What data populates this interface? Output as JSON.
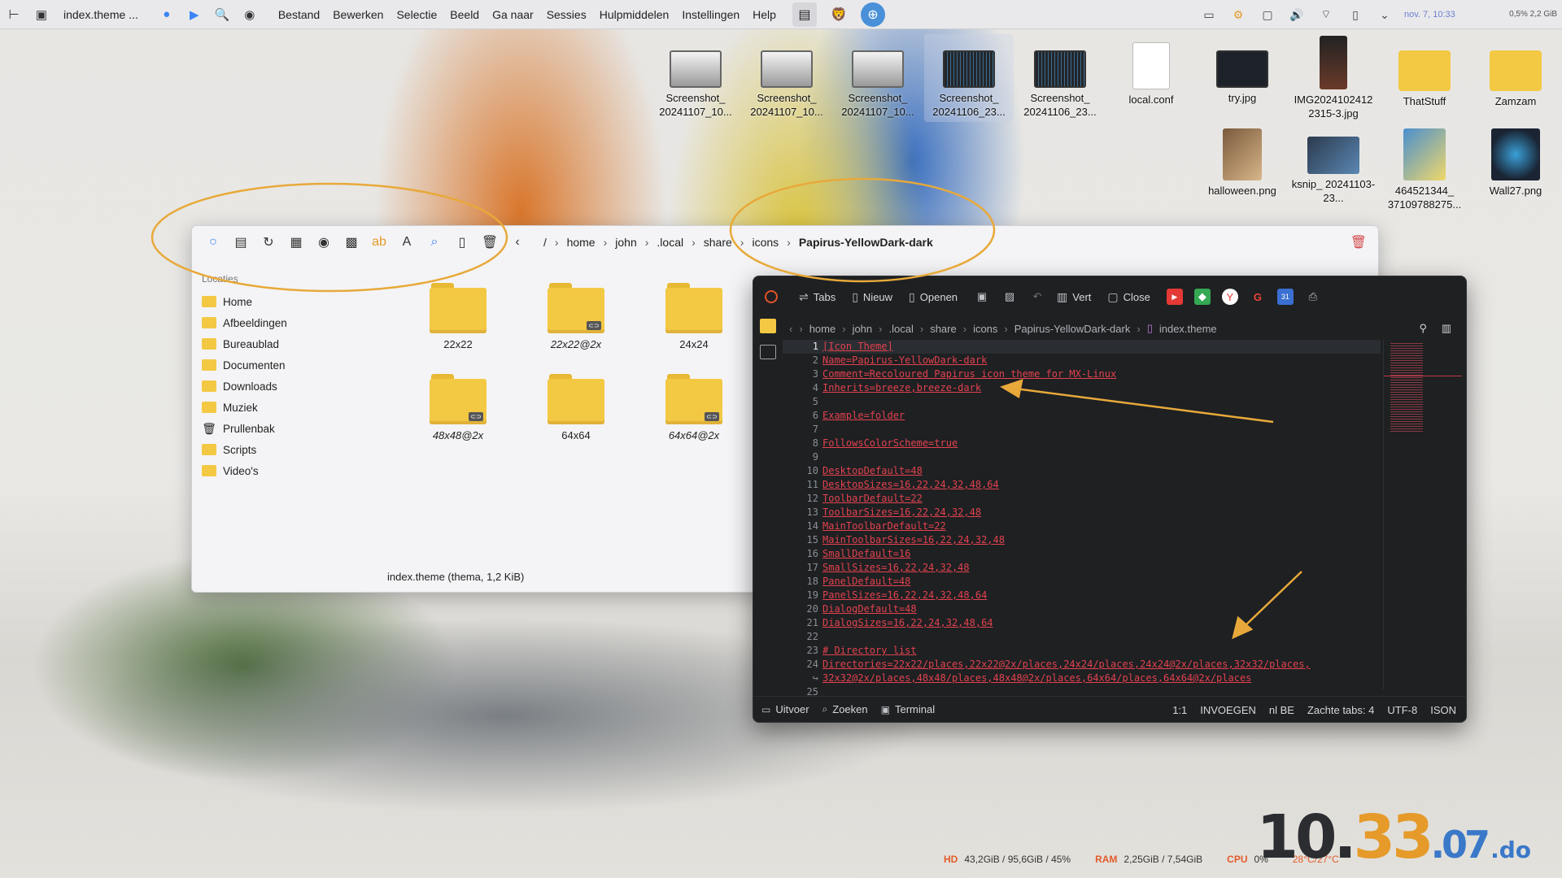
{
  "top_panel": {
    "window_title": "index.theme ...",
    "menu": [
      "Bestand",
      "Bewerken",
      "Selectie",
      "Beeld",
      "Ga naar",
      "Sessies",
      "Hulpmiddelen",
      "Instellingen",
      "Help"
    ],
    "clock": "nov. 7, 10:33",
    "sysinfo": "0,5%  2,2 GiB"
  },
  "desktop_icons": [
    {
      "label": "Screenshot_ 20241107_10..."
    },
    {
      "label": "Screenshot_ 20241107_10..."
    },
    {
      "label": "Screenshot_ 20241107_10..."
    },
    {
      "label": "Screenshot_ 20241106_23..."
    },
    {
      "label": "Screenshot_ 20241106_23..."
    },
    {
      "label": "local.conf"
    },
    {
      "label": "try.jpg"
    },
    {
      "label": "IMG2024102412 2315-3.jpg"
    },
    {
      "label": "ThatStuff"
    },
    {
      "label": "Zamzam"
    },
    {
      "label": "halloween.png"
    },
    {
      "label": "ksnip_ 20241103-23..."
    },
    {
      "label": "464521344_ 37109788275..."
    },
    {
      "label": "Wall27.png"
    }
  ],
  "file_manager": {
    "breadcrumb": [
      "/",
      "home",
      "john",
      ".local",
      "share",
      "icons",
      "Papirus-YellowDark-dark"
    ],
    "places_heading": "Locaties",
    "places": [
      "Home",
      "Afbeeldingen",
      "Bureaublad",
      "Documenten",
      "Downloads",
      "Muziek",
      "Prullenbak",
      "Scripts",
      "Video's"
    ],
    "folders": [
      {
        "name": "22x22",
        "italic": false,
        "badge": false
      },
      {
        "name": "22x22@2x",
        "italic": true,
        "badge": true
      },
      {
        "name": "24x24",
        "italic": false,
        "badge": false
      },
      {
        "name": "48x48@2x",
        "italic": true,
        "badge": true
      },
      {
        "name": "64x64",
        "italic": false,
        "badge": false
      },
      {
        "name": "64x64@2x",
        "italic": true,
        "badge": true
      }
    ],
    "status": "index.theme (thema, 1,2 KiB)"
  },
  "editor": {
    "toolbar": {
      "tabs": "Tabs",
      "new": "Nieuw",
      "open": "Openen",
      "split": "Vert",
      "close": "Close"
    },
    "nav_path": [
      "home",
      "john",
      ".local",
      "share",
      "icons",
      "Papirus-YellowDark-dark",
      "index.theme"
    ],
    "line_numbers": [
      "1",
      "2",
      "3",
      "4",
      "5",
      "6",
      "7",
      "8",
      "9",
      "10",
      "11",
      "12",
      "13",
      "14",
      "15",
      "16",
      "17",
      "18",
      "19",
      "20",
      "21",
      "22",
      "23",
      "24",
      "↪",
      "25"
    ],
    "lines": [
      "[Icon Theme]",
      "Name=Papirus-YellowDark-dark",
      "Comment=Recoloured Papirus icon theme for MX-Linux",
      "Inherits=breeze,breeze-dark",
      "",
      "Example=folder",
      "",
      "FollowsColorScheme=true",
      "",
      "DesktopDefault=48",
      "DesktopSizes=16,22,24,32,48,64",
      "ToolbarDefault=22",
      "ToolbarSizes=16,22,24,32,48",
      "MainToolbarDefault=22",
      "MainToolbarSizes=16,22,24,32,48",
      "SmallDefault=16",
      "SmallSizes=16,22,24,32,48",
      "PanelDefault=48",
      "PanelSizes=16,22,24,32,48,64",
      "DialogDefault=48",
      "DialogSizes=16,22,24,32,48,64",
      "",
      "# Directory list",
      "Directories=22x22/places,22x22@2x/places,24x24/places,24x24@2x/places,32x32/places,",
      "32x32@2x/places,48x48/places,48x48@2x/places,64x64/places,64x64@2x/places",
      ""
    ],
    "status_left": [
      "Uitvoer",
      "Zoeken",
      "Terminal"
    ],
    "status_right": [
      "1:1",
      "INVOEGEN",
      "nl BE",
      "Zachte tabs: 4",
      "UTF-8",
      "ISON"
    ]
  },
  "sysbar": {
    "hd_label": "HD",
    "hd_value": "43,2GiB / 95,6GiB / 45%",
    "ram_label": "RAM",
    "ram_value": "2,25GiB / 7,54GiB",
    "cpu_label": "CPU",
    "cpu_value": "0%",
    "temp": "28°C/27°C"
  },
  "big_clock": {
    "hour": "10.",
    "minute": "33",
    "second": ".07",
    "day": ".do"
  },
  "colors": {
    "accent_orange": "#e59a2a",
    "error_red": "#e2424f",
    "folder_yellow": "#f3c843"
  }
}
